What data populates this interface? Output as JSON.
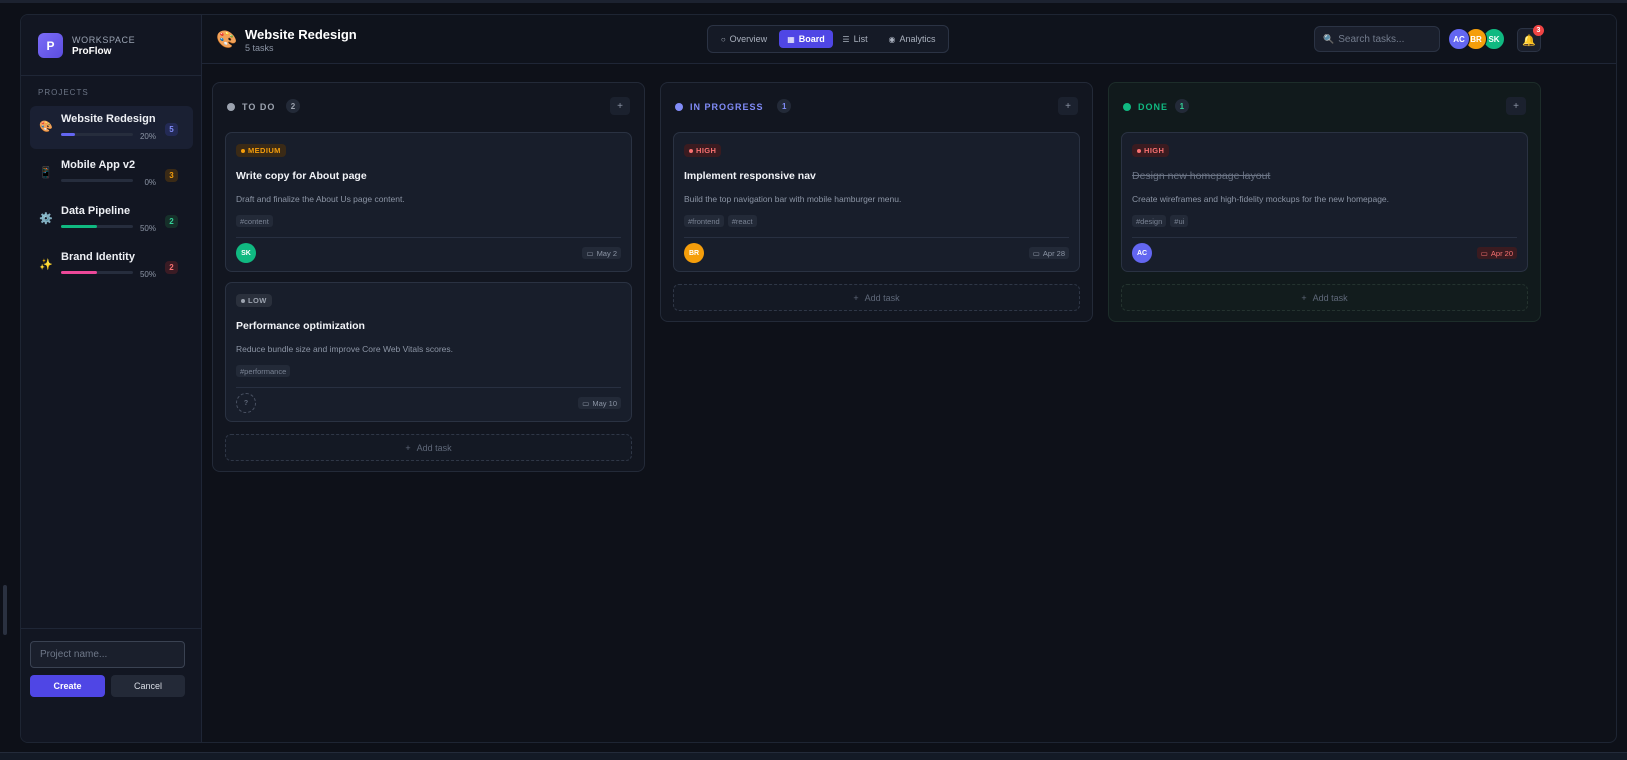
{
  "workspace": {
    "logo_letter": "P",
    "label": "WORKSPACE",
    "name": "ProFlow"
  },
  "sidebar": {
    "section_label": "PROJECTS",
    "projects": [
      {
        "icon": "🎨",
        "icon_name": "palette-icon",
        "name": "Website Redesign",
        "progress_label": "20%",
        "progress": 0.2,
        "count": "5",
        "color": "#6366f1",
        "count_color": "#818cf8",
        "count_bg": "#232a55",
        "active": true
      },
      {
        "icon": "📱",
        "icon_name": "phone-icon",
        "name": "Mobile App v2",
        "progress_label": "0%",
        "progress": 0.0,
        "count": "3",
        "color": "#f59e0b",
        "count_color": "#f59e0b",
        "count_bg": "#3a2a16",
        "active": false
      },
      {
        "icon": "⚙️",
        "icon_name": "gear-icon",
        "name": "Data Pipeline",
        "progress_label": "50%",
        "progress": 0.5,
        "count": "2",
        "color": "#10b981",
        "count_color": "#34d399",
        "count_bg": "#16302a",
        "active": false
      },
      {
        "icon": "✨",
        "icon_name": "sparkles-icon",
        "name": "Brand Identity",
        "progress_label": "50%",
        "progress": 0.5,
        "count": "2",
        "color": "#ec4899",
        "count_color": "#f87171",
        "count_bg": "#3a1b24",
        "active": false
      }
    ],
    "new_project": {
      "placeholder": "Project name...",
      "create_label": "Create",
      "cancel_label": "Cancel"
    }
  },
  "header": {
    "icon": "🎨",
    "title": "Website Redesign",
    "subtitle": "5 tasks",
    "tabs": [
      {
        "label": "Overview",
        "glyph": "○",
        "active": false
      },
      {
        "label": "Board",
        "glyph": "▦",
        "active": true
      },
      {
        "label": "List",
        "glyph": "☰",
        "active": false
      },
      {
        "label": "Analytics",
        "glyph": "◉",
        "active": false
      }
    ],
    "search_placeholder": "Search tasks...",
    "avatars": [
      {
        "initials": "AC",
        "color": "#6366f1"
      },
      {
        "initials": "BR",
        "color": "#f59e0b"
      },
      {
        "initials": "SK",
        "color": "#10b981"
      }
    ],
    "notifications": "3"
  },
  "board": {
    "add_task_label": "Add task",
    "columns": [
      {
        "title": "TO DO",
        "count": "2",
        "color": "#9ca3af",
        "count_color": "#9ca3af",
        "cards": [
          {
            "priority": "MEDIUM",
            "priority_color": "#f59e0b",
            "priority_bg": "#3a2a16",
            "title": "Write copy for About page",
            "desc": "Draft and finalize the About Us page content.",
            "tags": [
              "#content"
            ],
            "assignee": "SK",
            "assignee_color": "#10b981",
            "due": "May 2",
            "overdue": false,
            "done": false
          },
          {
            "priority": "LOW",
            "priority_color": "#9ca3af",
            "priority_bg": "#2a303c",
            "title": "Performance optimization",
            "desc": "Reduce bundle size and improve Core Web Vitals scores.",
            "tags": [
              "#performance"
            ],
            "assignee": "?",
            "assignee_color": "",
            "due": "May 10",
            "overdue": false,
            "done": false
          }
        ]
      },
      {
        "title": "IN PROGRESS",
        "count": "1",
        "color": "#818cf8",
        "count_color": "#818cf8",
        "cards": [
          {
            "priority": "HIGH",
            "priority_color": "#f87171",
            "priority_bg": "#3a1b20",
            "title": "Implement responsive nav",
            "desc": "Build the top navigation bar with mobile hamburger menu.",
            "tags": [
              "#frontend",
              "#react"
            ],
            "assignee": "BR",
            "assignee_color": "#f59e0b",
            "due": "Apr 28",
            "overdue": false,
            "done": false
          }
        ]
      },
      {
        "title": "DONE",
        "count": "1",
        "color": "#10b981",
        "count_color": "#34d399",
        "cards": [
          {
            "priority": "HIGH",
            "priority_color": "#f87171",
            "priority_bg": "#3a1b20",
            "title": "Design new homepage layout",
            "desc": "Create wireframes and high-fidelity mockups for the new homepage.",
            "tags": [
              "#design",
              "#ui"
            ],
            "assignee": "AC",
            "assignee_color": "#6366f1",
            "due": "Apr 20",
            "overdue": true,
            "done": true
          }
        ]
      }
    ]
  }
}
